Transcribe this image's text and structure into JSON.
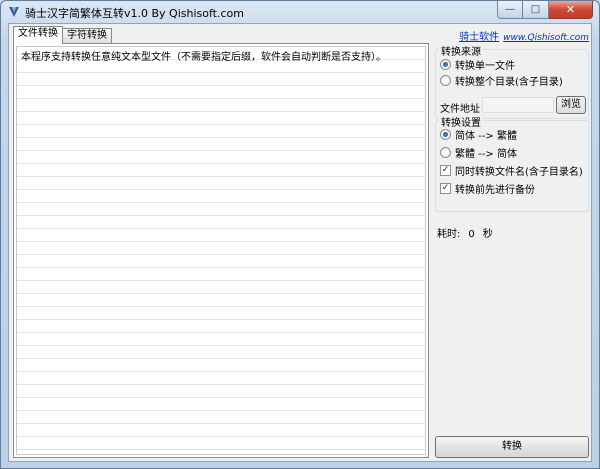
{
  "window": {
    "title": "骑士汉字简繁体互转v1.0 By Qishisoft.com",
    "controls": {
      "minimize": "—",
      "maximize": "□",
      "close": "✕"
    }
  },
  "tabs": [
    {
      "label": "文件转换",
      "active": true
    },
    {
      "label": "字符转换",
      "active": false
    }
  ],
  "main": {
    "info_text": "本程序支持转换任意纯文本型文件（不需要指定后缀，软件会自动判断是否支持）。"
  },
  "sidebar": {
    "site_name": "骑士软件",
    "site_url": "www.Qishisoft.com",
    "source_group": {
      "title": "转换来源",
      "options": [
        {
          "label": "转换单一文件",
          "selected": true
        },
        {
          "label": "转换整个目录(含子目录)",
          "selected": false
        }
      ],
      "file_label": "文件地址",
      "file_value": "",
      "browse_label": "浏览"
    },
    "settings_group": {
      "title": "转换设置",
      "direction_options": [
        {
          "label": "简体 --> 繁體",
          "selected": true
        },
        {
          "label": "繁體 --> 简体",
          "selected": false
        }
      ],
      "checkboxes": [
        {
          "label": "同时转换文件名(含子目录名)",
          "checked": true
        },
        {
          "label": "转换前先进行备份",
          "checked": true
        }
      ]
    },
    "elapsed": {
      "label": "耗时:",
      "value": "0",
      "unit": "秒"
    },
    "convert_label": "转换"
  },
  "colors": {
    "accent": "#0033cc",
    "title_gradient_top": "#dbe7f4",
    "close_red": "#c94a35"
  }
}
